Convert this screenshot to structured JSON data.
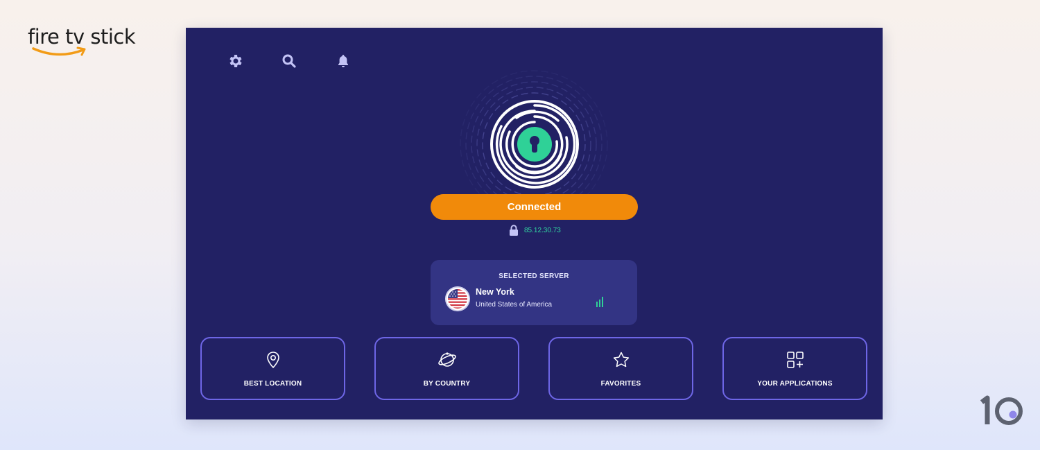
{
  "branding": {
    "device_logo": "fire tv stick",
    "device_logo_icon": "amazon-smile-icon",
    "corner_mark": "10",
    "accent_orange": "#f18a0a"
  },
  "app": {
    "background_color": "#222164",
    "top_icons": [
      {
        "name": "settings",
        "icon": "gear-icon"
      },
      {
        "name": "search",
        "icon": "search-icon"
      },
      {
        "name": "notifications",
        "icon": "bell-icon"
      }
    ],
    "status": {
      "button_label": "Connected",
      "button_color": "#f18a0a",
      "ip_address": "85.12.30.73",
      "ip_color": "#31d6a0",
      "lock_icon": "lock-icon",
      "shield_icon": "keyhole-shield-icon"
    },
    "selected_server": {
      "title": "SELECTED SERVER",
      "city": "New York",
      "country": "United States of America",
      "flag_icon": "us-flag-icon",
      "signal_icon": "signal-bars-icon"
    },
    "tiles": [
      {
        "label": "BEST LOCATION",
        "icon": "location-pin-icon"
      },
      {
        "label": "BY COUNTRY",
        "icon": "globe-icon"
      },
      {
        "label": "FAVORITES",
        "icon": "star-icon"
      },
      {
        "label": "YOUR APPLICATIONS",
        "icon": "apps-add-icon"
      }
    ]
  }
}
